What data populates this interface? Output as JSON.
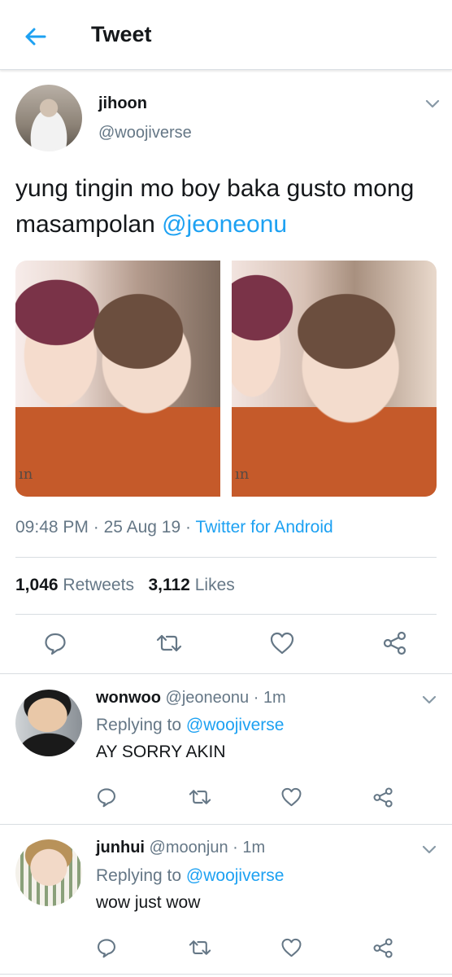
{
  "header": {
    "title": "Tweet",
    "back_icon": "arrow-left-icon"
  },
  "tweet": {
    "author_name": "jihoon",
    "author_handle": "@woojiverse",
    "text_main": "yung tingin mo boy baka gusto mong masampolan ",
    "text_mention": "@jeoneonu",
    "media_watermark_left": "ın",
    "media_watermark_right": "ın",
    "time": "09:48 PM",
    "date": "25 Aug 19",
    "separator": " · ",
    "source": "Twitter for Android",
    "retweets_count": "1,046",
    "retweets_label": "Retweets",
    "likes_count": "3,112",
    "likes_label": "Likes"
  },
  "replies": [
    {
      "name": "wonwoo",
      "handle": "@jeoneonu",
      "time": "1m",
      "replying_prefix": "Replying to ",
      "replying_to": "@woojiverse",
      "text": "AY SORRY AKIN"
    },
    {
      "name": "junhui",
      "handle": "@moonjun",
      "time": "1m",
      "replying_prefix": "Replying to ",
      "replying_to": "@woojiverse",
      "text": "wow just wow"
    }
  ],
  "colors": {
    "accent": "#1da1f2",
    "secondary_text": "#657786",
    "primary_text": "#14171a",
    "divider": "#d8dde1"
  }
}
